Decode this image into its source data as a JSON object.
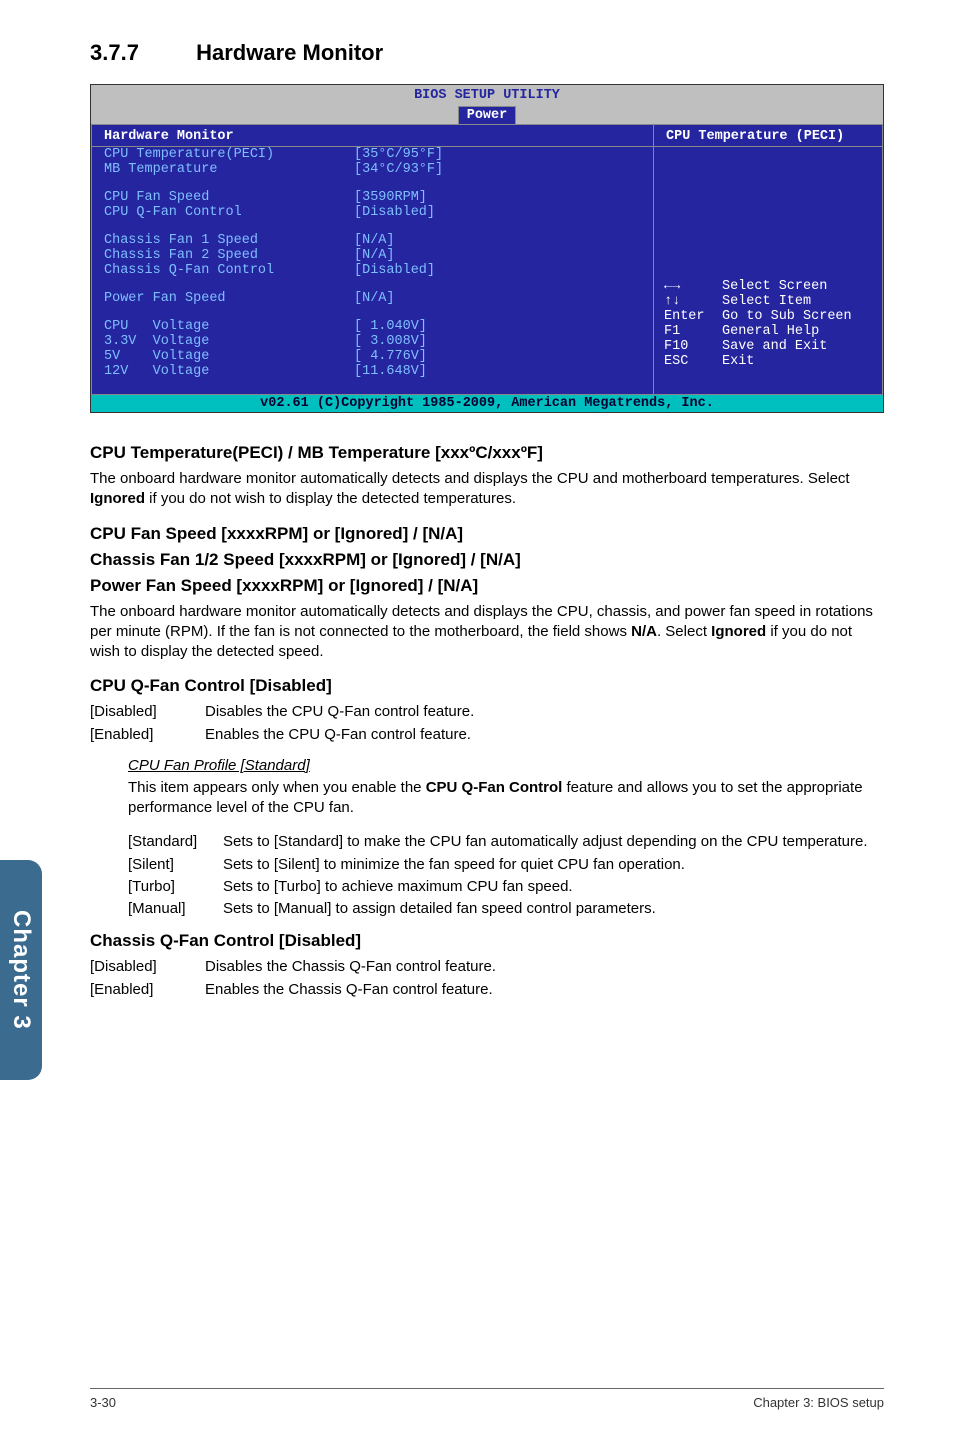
{
  "sideTab": "Chapter 3",
  "section": {
    "number": "3.7.7",
    "title": "Hardware Monitor"
  },
  "bios": {
    "utilityTitle": "BIOS SETUP UTILITY",
    "tab": "Power",
    "leftHeader": "Hardware Monitor",
    "rightHeader": "CPU Temperature (PECI)",
    "rows": [
      {
        "label": "CPU Temperature(PECI)",
        "value": "[35°C/95°F]"
      },
      {
        "label": "MB Temperature",
        "value": "[34°C/93°F]"
      }
    ],
    "rows2": [
      {
        "label": "CPU Fan Speed",
        "value": "[3590RPM]"
      },
      {
        "label": "CPU Q-Fan Control",
        "value": "[Disabled]"
      }
    ],
    "rows3": [
      {
        "label": "Chassis Fan 1 Speed",
        "value": "[N/A]"
      },
      {
        "label": "Chassis Fan 2 Speed",
        "value": "[N/A]"
      },
      {
        "label": "Chassis Q-Fan Control",
        "value": "[Disabled]"
      }
    ],
    "rows4": [
      {
        "label": "Power Fan Speed",
        "value": "[N/A]"
      }
    ],
    "rows5": [
      {
        "label": "CPU   Voltage",
        "value": "[ 1.040V]"
      },
      {
        "label": "3.3V  Voltage",
        "value": "[ 3.008V]"
      },
      {
        "label": "5V    Voltage",
        "value": "[ 4.776V]"
      },
      {
        "label": "12V   Voltage",
        "value": "[11.648V]"
      }
    ],
    "help": [
      {
        "key": "←→",
        "text": "Select Screen"
      },
      {
        "key": "↑↓",
        "text": "Select Item"
      },
      {
        "key": "Enter",
        "text": "Go to Sub Screen"
      },
      {
        "key": "F1",
        "text": "General Help"
      },
      {
        "key": "F10",
        "text": "Save and Exit"
      },
      {
        "key": "ESC",
        "text": "Exit"
      }
    ],
    "footer": "v02.61 (C)Copyright 1985-2009, American Megatrends, Inc."
  },
  "h_cpu_temp": "CPU Temperature(PECI) / MB Temperature [xxxºC/xxxºF]",
  "p_cpu_temp_a": "The onboard hardware monitor automatically detects and displays the CPU and motherboard temperatures. Select ",
  "p_cpu_temp_b": "Ignored",
  "p_cpu_temp_c": " if you do not wish to display the detected temperatures.",
  "h_fan_1": "CPU Fan Speed [xxxxRPM] or [Ignored] / [N/A]",
  "h_fan_2": "Chassis Fan 1/2 Speed [xxxxRPM] or [Ignored] / [N/A]",
  "h_fan_3": "Power Fan Speed [xxxxRPM] or [Ignored] / [N/A]",
  "p_fan_a": "The onboard hardware monitor automatically detects and displays the CPU, chassis, and power fan speed in rotations per minute (RPM). If the fan is not connected to the motherboard, the field shows ",
  "p_fan_b": "N/A",
  "p_fan_c": ". Select ",
  "p_fan_d": "Ignored",
  "p_fan_e": " if you do not wish to display the detected speed.",
  "h_cpuq": "CPU Q-Fan Control [Disabled]",
  "cpuq_opts": [
    {
      "k": "[Disabled]",
      "v": "Disables the CPU Q-Fan control feature."
    },
    {
      "k": "[Enabled]",
      "v": "Enables the CPU Q-Fan control feature."
    }
  ],
  "h_profile": "CPU Fan Profile [Standard]",
  "p_profile_a": "This item appears only when you enable the ",
  "p_profile_b": "CPU Q-Fan Control",
  "p_profile_c": " feature and allows you to set the appropriate performance level of the CPU fan.",
  "profile_opts": [
    {
      "k": "[Standard]",
      "v": "Sets to [Standard] to make the CPU fan automatically adjust depending on the CPU temperature."
    },
    {
      "k": "[Silent]",
      "v": "Sets to [Silent] to minimize the fan speed for quiet CPU fan operation."
    },
    {
      "k": "[Turbo]",
      "v": "Sets to [Turbo] to achieve maximum CPU fan speed."
    },
    {
      "k": "[Manual]",
      "v": "Sets to [Manual] to assign detailed fan speed control parameters."
    }
  ],
  "h_chassisq": "Chassis Q-Fan Control [Disabled]",
  "chassisq_opts": [
    {
      "k": "[Disabled]",
      "v": "Disables the Chassis Q-Fan control feature."
    },
    {
      "k": "[Enabled]",
      "v": "Enables the Chassis Q-Fan control feature."
    }
  ],
  "footerLeft": "3-30",
  "footerRight": "Chapter 3: BIOS setup"
}
